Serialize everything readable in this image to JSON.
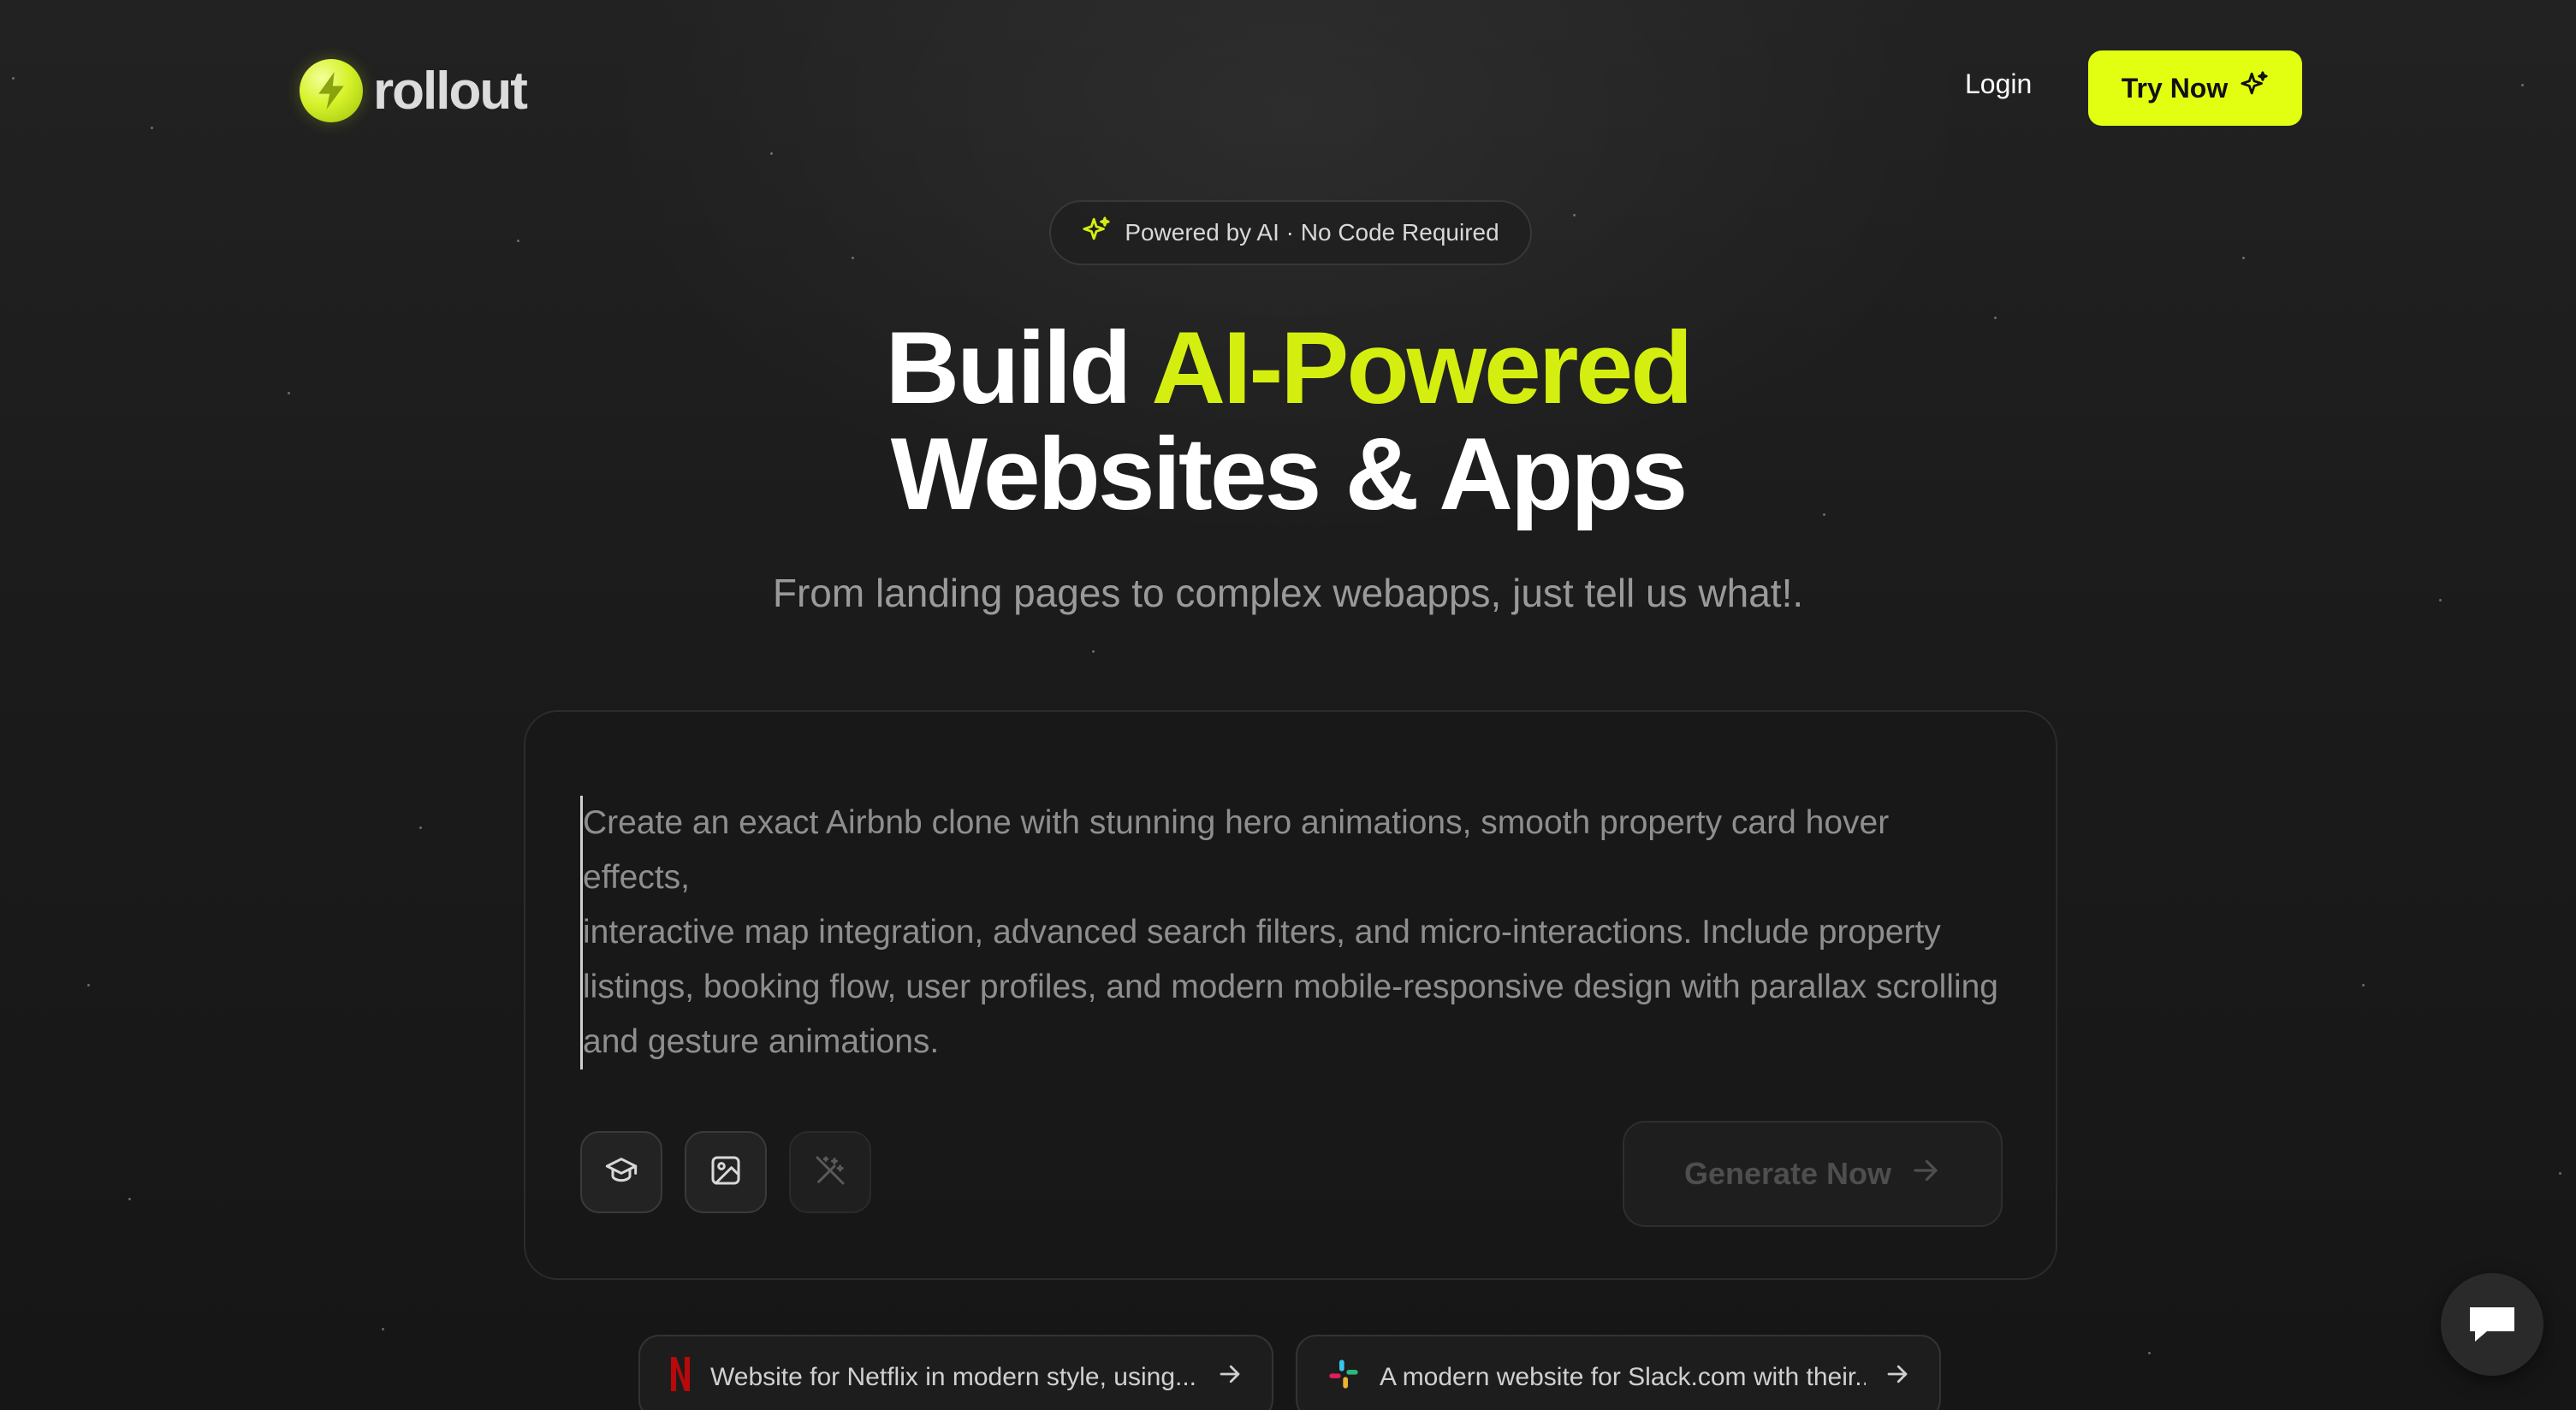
{
  "nav": {
    "logo_text": "rollout",
    "login_label": "Login",
    "try_now_label": "Try Now"
  },
  "hero": {
    "badge_text": "Powered by AI · No Code Required",
    "title_part1": "Build ",
    "title_accent": "AI-Powered",
    "title_line2": "Websites & Apps",
    "subtitle": "From landing pages to complex webapps, just tell us what!."
  },
  "prompt": {
    "placeholder_lines": [
      "Create an exact Airbnb clone with stunning hero animations, smooth property card hover effects,",
      "interactive map integration, advanced search filters, and micro-interactions. Include property",
      "listings, booking flow, user profiles, and modern mobile-responsive design with parallax scrolling",
      "and gesture animations."
    ],
    "tools": [
      "graduation-cap-icon",
      "image-icon",
      "magic-wand-icon"
    ],
    "generate_label": "Generate Now"
  },
  "suggestions": [
    {
      "brand_icon": "netflix-logo-icon",
      "label": "Website for Netflix in modern style, using..."
    },
    {
      "brand_icon": "slack-logo-icon",
      "label": "A modern website for Slack.com with their..."
    }
  ],
  "colors": {
    "accent": "#e2ff12",
    "accent_text": "#d4ef0f",
    "background": "#1b1b1b",
    "netflix_red": "#b9090b"
  }
}
